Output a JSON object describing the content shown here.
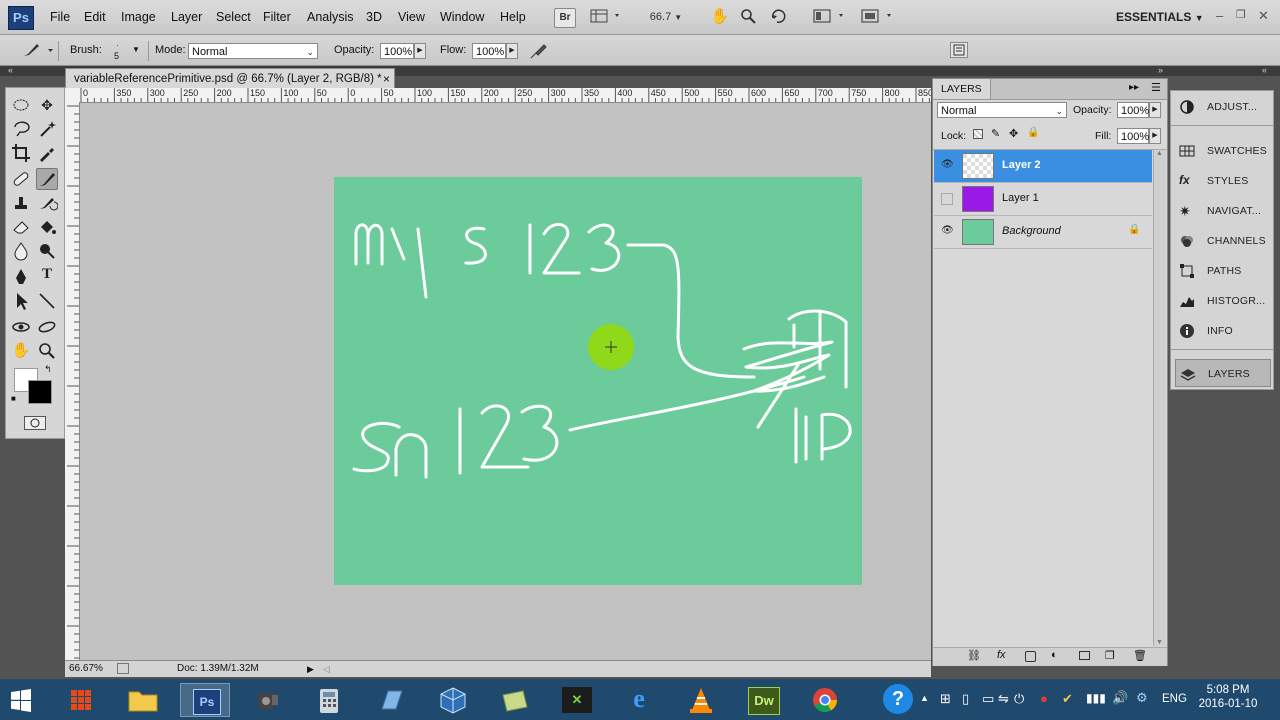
{
  "app": {
    "logo_text": "Ps",
    "menus": [
      "File",
      "Edit",
      "Image",
      "Layer",
      "Select",
      "Filter",
      "Analysis",
      "3D",
      "View",
      "Window",
      "Help"
    ],
    "bridge_label": "Br",
    "zoom_value": "66.7",
    "workspace": "ESSENTIALS"
  },
  "options": {
    "brush_label": "Brush:",
    "brush_size": "5",
    "mode_label": "Mode:",
    "mode_value": "Normal",
    "opacity_label": "Opacity:",
    "opacity_value": "100%",
    "flow_label": "Flow:",
    "flow_value": "100%"
  },
  "document": {
    "tab_title": "variableReferencePrimitive.psd @ 66.7% (Layer 2, RGB/8) *",
    "close": "×",
    "ruler_labels": [
      "0",
      "350",
      "300",
      "250",
      "200",
      "150",
      "100",
      "50",
      "0",
      "50",
      "100",
      "150",
      "200",
      "250",
      "300",
      "350",
      "400",
      "450",
      "500",
      "550",
      "600",
      "650",
      "700",
      "750",
      "800",
      "850"
    ],
    "zoom_status": "66.67%",
    "doc_info": "Doc: 1.39M/1.32M"
  },
  "layers_panel": {
    "tab": "LAYERS",
    "blend_mode": "Normal",
    "opacity_label": "Opacity:",
    "opacity_value": "100%",
    "lock_label": "Lock:",
    "fill_label": "Fill:",
    "fill_value": "100%",
    "layers": [
      {
        "name": "Layer 2",
        "visible": true,
        "active": true
      },
      {
        "name": "Layer 1",
        "visible": false,
        "active": false
      },
      {
        "name": "Background",
        "visible": true,
        "active": false,
        "locked": true
      }
    ]
  },
  "dock": {
    "items": [
      {
        "label": "ADJUST..."
      },
      {
        "label": "SWATCHES"
      },
      {
        "label": "STYLES"
      },
      {
        "label": "NAVIGAT..."
      },
      {
        "label": "CHANNELS"
      },
      {
        "label": "PATHS"
      },
      {
        "label": "HISTOGR..."
      },
      {
        "label": "INFO"
      },
      {
        "label": "LAYERS"
      }
    ]
  },
  "taskbar": {
    "language": "ENG",
    "time": "5:08 PM",
    "date": "2016-01-10",
    "dw_label": "Dw"
  },
  "colors": {
    "canvas_bg": "#6bcb9b",
    "active_layer": "#3b8fe0",
    "layer1_thumb": "#9b19e6",
    "brush_cursor": "#8fd81a"
  }
}
